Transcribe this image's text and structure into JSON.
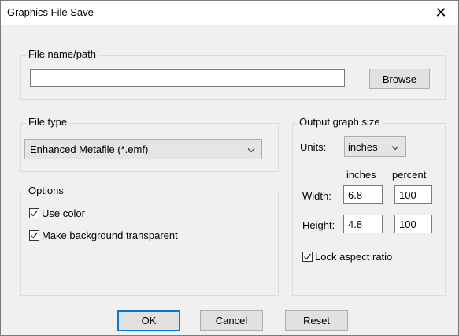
{
  "window": {
    "title": "Graphics File Save",
    "close_glyph": "✕"
  },
  "file_path": {
    "group_label": "File name/path",
    "value": "",
    "browse_label": "Browse"
  },
  "file_type": {
    "group_label": "File type",
    "selected": "Enhanced Metafile (*.emf)"
  },
  "options": {
    "group_label": "Options",
    "use_color": {
      "label_prefix": "Use ",
      "label_mnemonic": "c",
      "label_suffix": "olor",
      "checked": true
    },
    "transparent_bg": {
      "label": "Make background transparent",
      "checked": true
    }
  },
  "output_size": {
    "group_label": "Output graph size",
    "units_label": "Units:",
    "units_value": "inches",
    "col_inches": "inches",
    "col_percent": "percent",
    "width_label": "Width:",
    "width_inches": "6.8",
    "width_percent": "100",
    "height_label": "Height:",
    "height_inches": "4.8",
    "height_percent": "100",
    "lock_aspect": {
      "label": "Lock aspect ratio",
      "checked": true
    }
  },
  "buttons": {
    "ok": "OK",
    "cancel": "Cancel",
    "reset": "Reset"
  },
  "colors": {
    "accent": "#0078d7",
    "dialog_bg": "#f0f0f0"
  }
}
